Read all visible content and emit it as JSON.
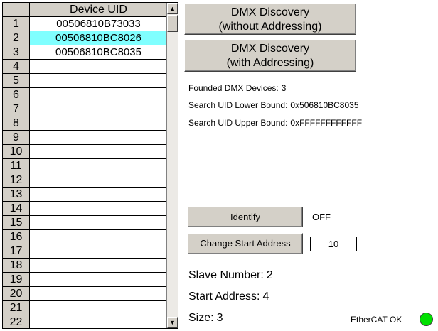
{
  "table": {
    "column_header": "Device UID",
    "rows": [
      {
        "num": "1",
        "uid": "00506810B73033"
      },
      {
        "num": "2",
        "uid": "00506810BC8026",
        "selected": true
      },
      {
        "num": "3",
        "uid": "00506810BC8035"
      },
      {
        "num": "4",
        "uid": ""
      },
      {
        "num": "5",
        "uid": ""
      },
      {
        "num": "6",
        "uid": ""
      },
      {
        "num": "7",
        "uid": ""
      },
      {
        "num": "8",
        "uid": ""
      },
      {
        "num": "9",
        "uid": ""
      },
      {
        "num": "10",
        "uid": ""
      },
      {
        "num": "11",
        "uid": ""
      },
      {
        "num": "12",
        "uid": ""
      },
      {
        "num": "13",
        "uid": ""
      },
      {
        "num": "14",
        "uid": ""
      },
      {
        "num": "15",
        "uid": ""
      },
      {
        "num": "16",
        "uid": ""
      },
      {
        "num": "17",
        "uid": ""
      },
      {
        "num": "18",
        "uid": ""
      },
      {
        "num": "19",
        "uid": ""
      },
      {
        "num": "20",
        "uid": ""
      },
      {
        "num": "21",
        "uid": ""
      },
      {
        "num": "22",
        "uid": ""
      }
    ],
    "selected_color": "#80ffff"
  },
  "discovery": {
    "without": {
      "line1": "DMX Discovery",
      "line2": "(without Addressing)"
    },
    "with": {
      "line1": "DMX Discovery",
      "line2": "(with Addressing)"
    }
  },
  "info": {
    "founded_label": "Founded DMX Devices:",
    "founded_value": "3",
    "lower_label": "Search UID Lower Bound:",
    "lower_value": "0x506810BC8035",
    "upper_label": "Search UID Upper Bound:",
    "upper_value": "0xFFFFFFFFFFFF"
  },
  "identify": {
    "button_label": "Identify",
    "state": "OFF"
  },
  "change_start": {
    "button_label": "Change Start Address",
    "value": "10"
  },
  "status": {
    "slave_label": "Slave Number:",
    "slave_value": "2",
    "start_label": "Start Address:",
    "start_value": "4",
    "size_label": "Size:",
    "size_value": "3"
  },
  "ethercat": {
    "label": "EtherCAT OK",
    "led_color": "#00e000"
  }
}
